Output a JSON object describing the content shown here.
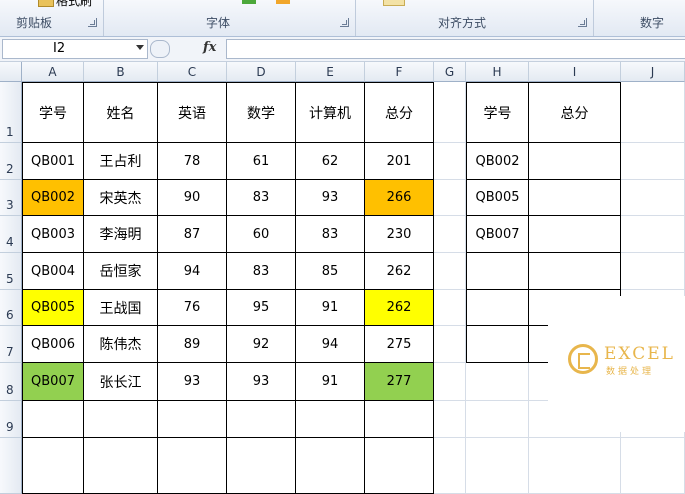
{
  "ribbon": {
    "clipboard_group": "剪贴板",
    "format_painter": "格式刷",
    "font_group": "字体",
    "alignment_group": "对齐方式",
    "number_group": "数字"
  },
  "formula_bar": {
    "name_box": "I2",
    "fx_label": "fx",
    "formula": ""
  },
  "columns": [
    "A",
    "B",
    "C",
    "D",
    "E",
    "F",
    "G",
    "H",
    "I",
    "J"
  ],
  "rows": [
    "1",
    "2",
    "3",
    "4",
    "5",
    "6",
    "7",
    "8",
    "9",
    ""
  ],
  "table": {
    "headers": [
      "学号",
      "姓名",
      "英语",
      "数学",
      "计算机",
      "总分"
    ],
    "records": [
      [
        "QB001",
        "王占利",
        "78",
        "61",
        "62",
        "201"
      ],
      [
        "QB002",
        "宋英杰",
        "90",
        "83",
        "93",
        "266"
      ],
      [
        "QB003",
        "李海明",
        "87",
        "60",
        "83",
        "230"
      ],
      [
        "QB004",
        "岳恒家",
        "94",
        "83",
        "85",
        "262"
      ],
      [
        "QB005",
        "王战国",
        "76",
        "95",
        "91",
        "262"
      ],
      [
        "QB006",
        "陈伟杰",
        "89",
        "92",
        "94",
        "275"
      ],
      [
        "QB007",
        "张长江",
        "93",
        "93",
        "91",
        "277"
      ]
    ]
  },
  "lookup": {
    "headers": [
      "学号",
      "总分"
    ],
    "ids": [
      "QB002",
      "QB005",
      "QB007",
      "",
      "",
      ""
    ]
  },
  "highlight_colors": {
    "QB002": "#ffc000",
    "QB005": "#ffff00",
    "QB007": "#92d050"
  },
  "watermark": {
    "title": "EXCEL",
    "subtitle": "数据处理"
  }
}
